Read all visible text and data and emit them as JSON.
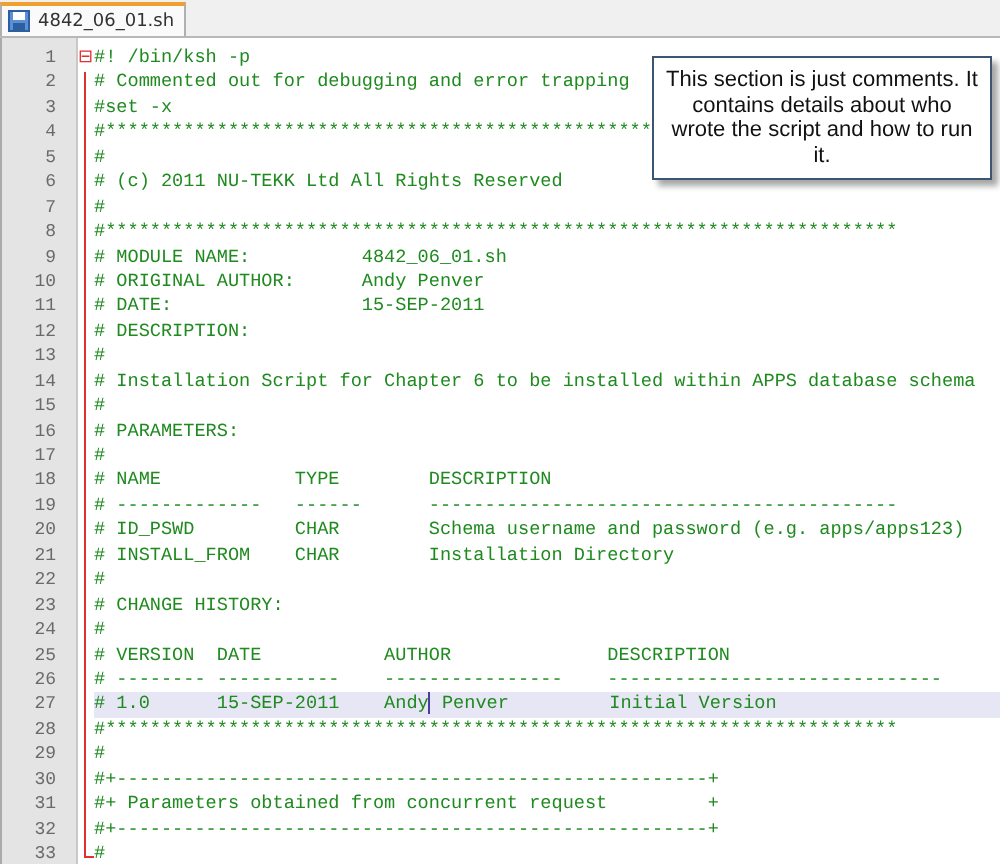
{
  "tabs": [
    {
      "label": "4842_06_01.sh",
      "selected": true
    }
  ],
  "editor": {
    "fold_marker": "⊟",
    "lines": [
      {
        "number": "1",
        "text": "#! /bin/ksh -p",
        "highlighted": false
      },
      {
        "number": "2",
        "text": "# Commented out for debugging and error trapping",
        "highlighted": false
      },
      {
        "number": "3",
        "text": "#set -x",
        "highlighted": false
      },
      {
        "number": "4",
        "text": "#*************************************************",
        "highlighted": false
      },
      {
        "number": "5",
        "text": "#",
        "highlighted": false
      },
      {
        "number": "6",
        "text": "# (c) 2011 NU-TEKK Ltd All Rights Reserved",
        "highlighted": false
      },
      {
        "number": "7",
        "text": "#",
        "highlighted": false
      },
      {
        "number": "8",
        "text": "#***********************************************************************",
        "highlighted": false
      },
      {
        "number": "9",
        "text": "# MODULE NAME:          4842_06_01.sh",
        "highlighted": false
      },
      {
        "number": "10",
        "text": "# ORIGINAL AUTHOR:      Andy Penver",
        "highlighted": false
      },
      {
        "number": "11",
        "text": "# DATE:                 15-SEP-2011",
        "highlighted": false
      },
      {
        "number": "12",
        "text": "# DESCRIPTION:",
        "highlighted": false
      },
      {
        "number": "13",
        "text": "#",
        "highlighted": false
      },
      {
        "number": "14",
        "text": "# Installation Script for Chapter 6 to be installed within APPS database schema",
        "highlighted": false
      },
      {
        "number": "15",
        "text": "#",
        "highlighted": false
      },
      {
        "number": "16",
        "text": "# PARAMETERS:",
        "highlighted": false
      },
      {
        "number": "17",
        "text": "#",
        "highlighted": false
      },
      {
        "number": "18",
        "text": "# NAME            TYPE        DESCRIPTION",
        "highlighted": false
      },
      {
        "number": "19",
        "text": "# -------------   ------      ------------------------------------------",
        "highlighted": false
      },
      {
        "number": "20",
        "text": "# ID_PSWD         CHAR        Schema username and password (e.g. apps/apps123)",
        "highlighted": false
      },
      {
        "number": "21",
        "text": "# INSTALL_FROM    CHAR        Installation Directory",
        "highlighted": false
      },
      {
        "number": "22",
        "text": "#",
        "highlighted": false
      },
      {
        "number": "23",
        "text": "# CHANGE HISTORY:",
        "highlighted": false
      },
      {
        "number": "24",
        "text": "#",
        "highlighted": false
      },
      {
        "number": "25",
        "text": "# VERSION  DATE           AUTHOR              DESCRIPTION",
        "highlighted": false
      },
      {
        "number": "26",
        "text": "# -------- -----------    ----------------    ------------------------------",
        "highlighted": false
      },
      {
        "number": "27",
        "text": "# 1.0      15-SEP-2011    Andy",
        "after_caret": " Penver         Initial Version",
        "highlighted": true
      },
      {
        "number": "28",
        "text": "#***********************************************************************",
        "highlighted": false
      },
      {
        "number": "29",
        "text": "#",
        "highlighted": false
      },
      {
        "number": "30",
        "text": "#+-----------------------------------------------------+",
        "highlighted": false
      },
      {
        "number": "31",
        "text": "#+ Parameters obtained from concurrent request         +",
        "highlighted": false
      },
      {
        "number": "32",
        "text": "#+-----------------------------------------------------+",
        "highlighted": false
      },
      {
        "number": "33",
        "text": "#",
        "highlighted": false
      }
    ]
  },
  "callout": {
    "text": "This section is just comments. It contains details about who wrote the script and how to run it."
  }
}
